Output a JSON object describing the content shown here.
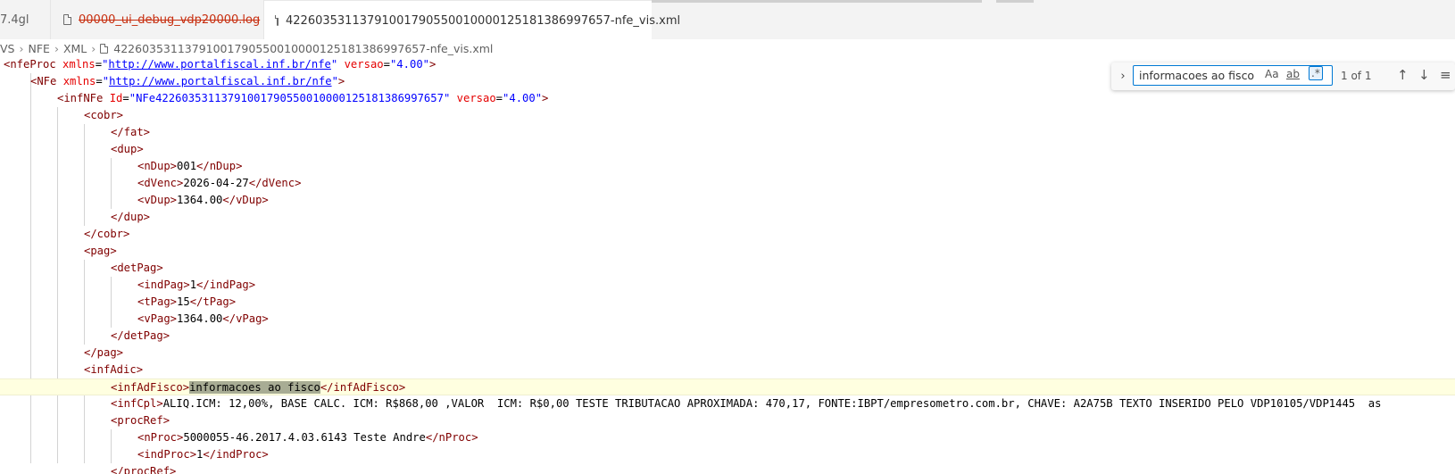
{
  "tabs": [
    {
      "label": "7.4gl"
    },
    {
      "label": "00000_ui_debug_vdp20000.log"
    },
    {
      "label": "422603531137910017905500100001251813869976​57-nfe_vis.xml"
    }
  ],
  "breadcrumb": {
    "items": [
      "VS",
      "NFE",
      "XML",
      "42260353113791001790550010000125181386997657-nfe_vis.xml"
    ]
  },
  "find": {
    "query": "informacoes ao fisco",
    "match_case": "Aa",
    "whole_word": "ab",
    "regex": ".*",
    "count": "1 of 1",
    "icons": [
      "chevron-right-icon",
      "arrow-up-icon",
      "arrow-down-icon",
      "menu-icon"
    ]
  },
  "code_lines": [
    {
      "indent": 0,
      "tokens": [
        [
          "tag",
          "<nfeProc"
        ],
        [
          "txt",
          " "
        ],
        [
          "attr",
          "xmlns"
        ],
        [
          "txt",
          "="
        ],
        [
          "str",
          "\""
        ],
        [
          "url",
          "http://www.portalfiscal.inf.br/nfe"
        ],
        [
          "str",
          "\""
        ],
        [
          "txt",
          " "
        ],
        [
          "attr",
          "versao"
        ],
        [
          "txt",
          "="
        ],
        [
          "str",
          "\"4.00\""
        ],
        [
          "tag",
          ">"
        ]
      ]
    },
    {
      "indent": 1,
      "tokens": [
        [
          "tag",
          "<NFe"
        ],
        [
          "txt",
          " "
        ],
        [
          "attr",
          "xmlns"
        ],
        [
          "txt",
          "="
        ],
        [
          "str",
          "\""
        ],
        [
          "url",
          "http://www.portalfiscal.inf.br/nfe"
        ],
        [
          "str",
          "\""
        ],
        [
          "tag",
          ">"
        ]
      ]
    },
    {
      "indent": 2,
      "tokens": [
        [
          "tag",
          "<infNFe"
        ],
        [
          "txt",
          " "
        ],
        [
          "attr",
          "Id"
        ],
        [
          "txt",
          "="
        ],
        [
          "str",
          "\"NFe42260353113791001790550010000125181386997657\""
        ],
        [
          "txt",
          " "
        ],
        [
          "attr",
          "versao"
        ],
        [
          "txt",
          "="
        ],
        [
          "str",
          "\"4.00\""
        ],
        [
          "tag",
          ">"
        ]
      ]
    },
    {
      "indent": 3,
      "tokens": [
        [
          "tag",
          "<cobr>"
        ]
      ]
    },
    {
      "indent": 4,
      "tokens": [
        [
          "tag",
          "</fat>"
        ]
      ]
    },
    {
      "indent": 4,
      "tokens": [
        [
          "tag",
          "<dup>"
        ]
      ]
    },
    {
      "indent": 5,
      "tokens": [
        [
          "tag",
          "<nDup>"
        ],
        [
          "txt",
          "001"
        ],
        [
          "tag",
          "</nDup>"
        ]
      ]
    },
    {
      "indent": 5,
      "tokens": [
        [
          "tag",
          "<dVenc>"
        ],
        [
          "txt",
          "2026-04-27"
        ],
        [
          "tag",
          "</dVenc>"
        ]
      ]
    },
    {
      "indent": 5,
      "tokens": [
        [
          "tag",
          "<vDup>"
        ],
        [
          "txt",
          "1364.00"
        ],
        [
          "tag",
          "</vDup>"
        ]
      ]
    },
    {
      "indent": 4,
      "tokens": [
        [
          "tag",
          "</dup>"
        ]
      ]
    },
    {
      "indent": 3,
      "tokens": [
        [
          "tag",
          "</cobr>"
        ]
      ]
    },
    {
      "indent": 3,
      "tokens": [
        [
          "tag",
          "<pag>"
        ]
      ]
    },
    {
      "indent": 4,
      "tokens": [
        [
          "tag",
          "<detPag>"
        ]
      ]
    },
    {
      "indent": 5,
      "tokens": [
        [
          "tag",
          "<indPag>"
        ],
        [
          "txt",
          "1"
        ],
        [
          "tag",
          "</indPag>"
        ]
      ]
    },
    {
      "indent": 5,
      "tokens": [
        [
          "tag",
          "<tPag>"
        ],
        [
          "txt",
          "15"
        ],
        [
          "tag",
          "</tPag>"
        ]
      ]
    },
    {
      "indent": 5,
      "tokens": [
        [
          "tag",
          "<vPag>"
        ],
        [
          "txt",
          "1364.00"
        ],
        [
          "tag",
          "</vPag>"
        ]
      ]
    },
    {
      "indent": 4,
      "tokens": [
        [
          "tag",
          "</detPag>"
        ]
      ]
    },
    {
      "indent": 3,
      "tokens": [
        [
          "tag",
          "</pag>"
        ]
      ]
    },
    {
      "indent": 3,
      "tokens": [
        [
          "tag",
          "<infAdic>"
        ]
      ]
    },
    {
      "indent": 4,
      "current": true,
      "tokens": [
        [
          "tag",
          "<infAdFisco>"
        ],
        [
          "match",
          "informacoes ao fisco"
        ],
        [
          "tag",
          "</infAdFisco>"
        ]
      ]
    },
    {
      "indent": 4,
      "tokens": [
        [
          "tag",
          "<infCpl>"
        ],
        [
          "txt",
          "ALIQ.ICM: 12,00%, BASE CALC. ICM: R$868,00 ,VALOR  ICM: R$0,00 TESTE TRIBUTACAO APROXIMADA: 470,17, FONTE:IBPT/empresometro.com.br, CHAVE: A2A75B TEXTO INSERIDO PELO VDP10105/VDP1445  as"
        ]
      ]
    },
    {
      "indent": 4,
      "tokens": [
        [
          "tag",
          "<procRef>"
        ]
      ]
    },
    {
      "indent": 5,
      "tokens": [
        [
          "tag",
          "<nProc>"
        ],
        [
          "txt",
          "5000055-46.2017.4.03.6143 Teste Andre"
        ],
        [
          "tag",
          "</nProc>"
        ]
      ]
    },
    {
      "indent": 5,
      "tokens": [
        [
          "tag",
          "<indProc>"
        ],
        [
          "txt",
          "1"
        ],
        [
          "tag",
          "</indProc>"
        ]
      ]
    },
    {
      "indent": 4,
      "tokens": [
        [
          "tag",
          "</procRef>"
        ]
      ]
    }
  ]
}
